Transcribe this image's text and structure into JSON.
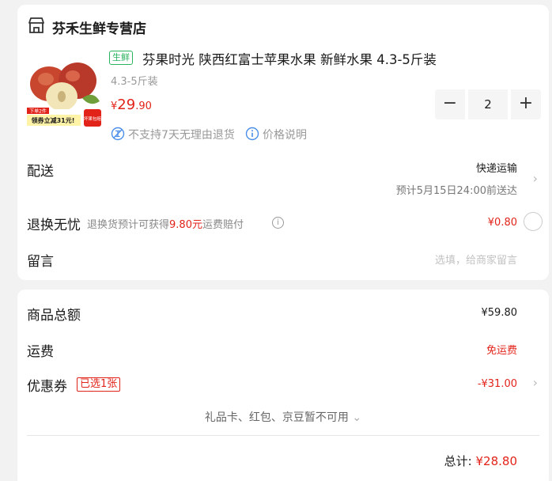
{
  "store": {
    "name": "芬禾生鲜专营店",
    "icon": "store-icon"
  },
  "product": {
    "tag": "生鲜",
    "title": "芬果时光 陕西红富士苹果水果 新鲜水果 4.3-5斤装",
    "spec": "4.3-5斤装",
    "price_currency": "¥",
    "price_int": "29",
    "price_dec": ".90",
    "quantity": "2",
    "minus": "−",
    "plus": "+",
    "thumb_badge_line1": "下单2件",
    "thumb_badge_line2": "领券立减31元!",
    "thumb_badge_right": "坏果包赔",
    "no_return": "不支持7天无理由退货",
    "price_explain": "价格说明"
  },
  "delivery": {
    "label": "配送",
    "method": "快递运输",
    "eta": "预计5月15日24:00前送达"
  },
  "return_insurance": {
    "label": "退换无忧",
    "desc_prefix": "退换货预计可获得",
    "desc_amount": "9.80元",
    "desc_suffix": "运费赔付",
    "price": "¥0.80"
  },
  "message": {
    "label": "留言",
    "placeholder": "选填，给商家留言"
  },
  "summary": {
    "goods_total_label": "商品总额",
    "goods_total": "¥59.80",
    "shipping_label": "运费",
    "shipping": "免运费",
    "coupon_label": "优惠券",
    "coupon_tag": "已选1张",
    "coupon_value": "-¥31.00",
    "other_pay": "礼品卡、红包、京豆暂不可用",
    "total_label": "总计:",
    "total": "¥28.80"
  },
  "colors": {
    "accent_red": "#e2231a",
    "fresh_green": "#2ab25d",
    "muted": "#999999"
  }
}
